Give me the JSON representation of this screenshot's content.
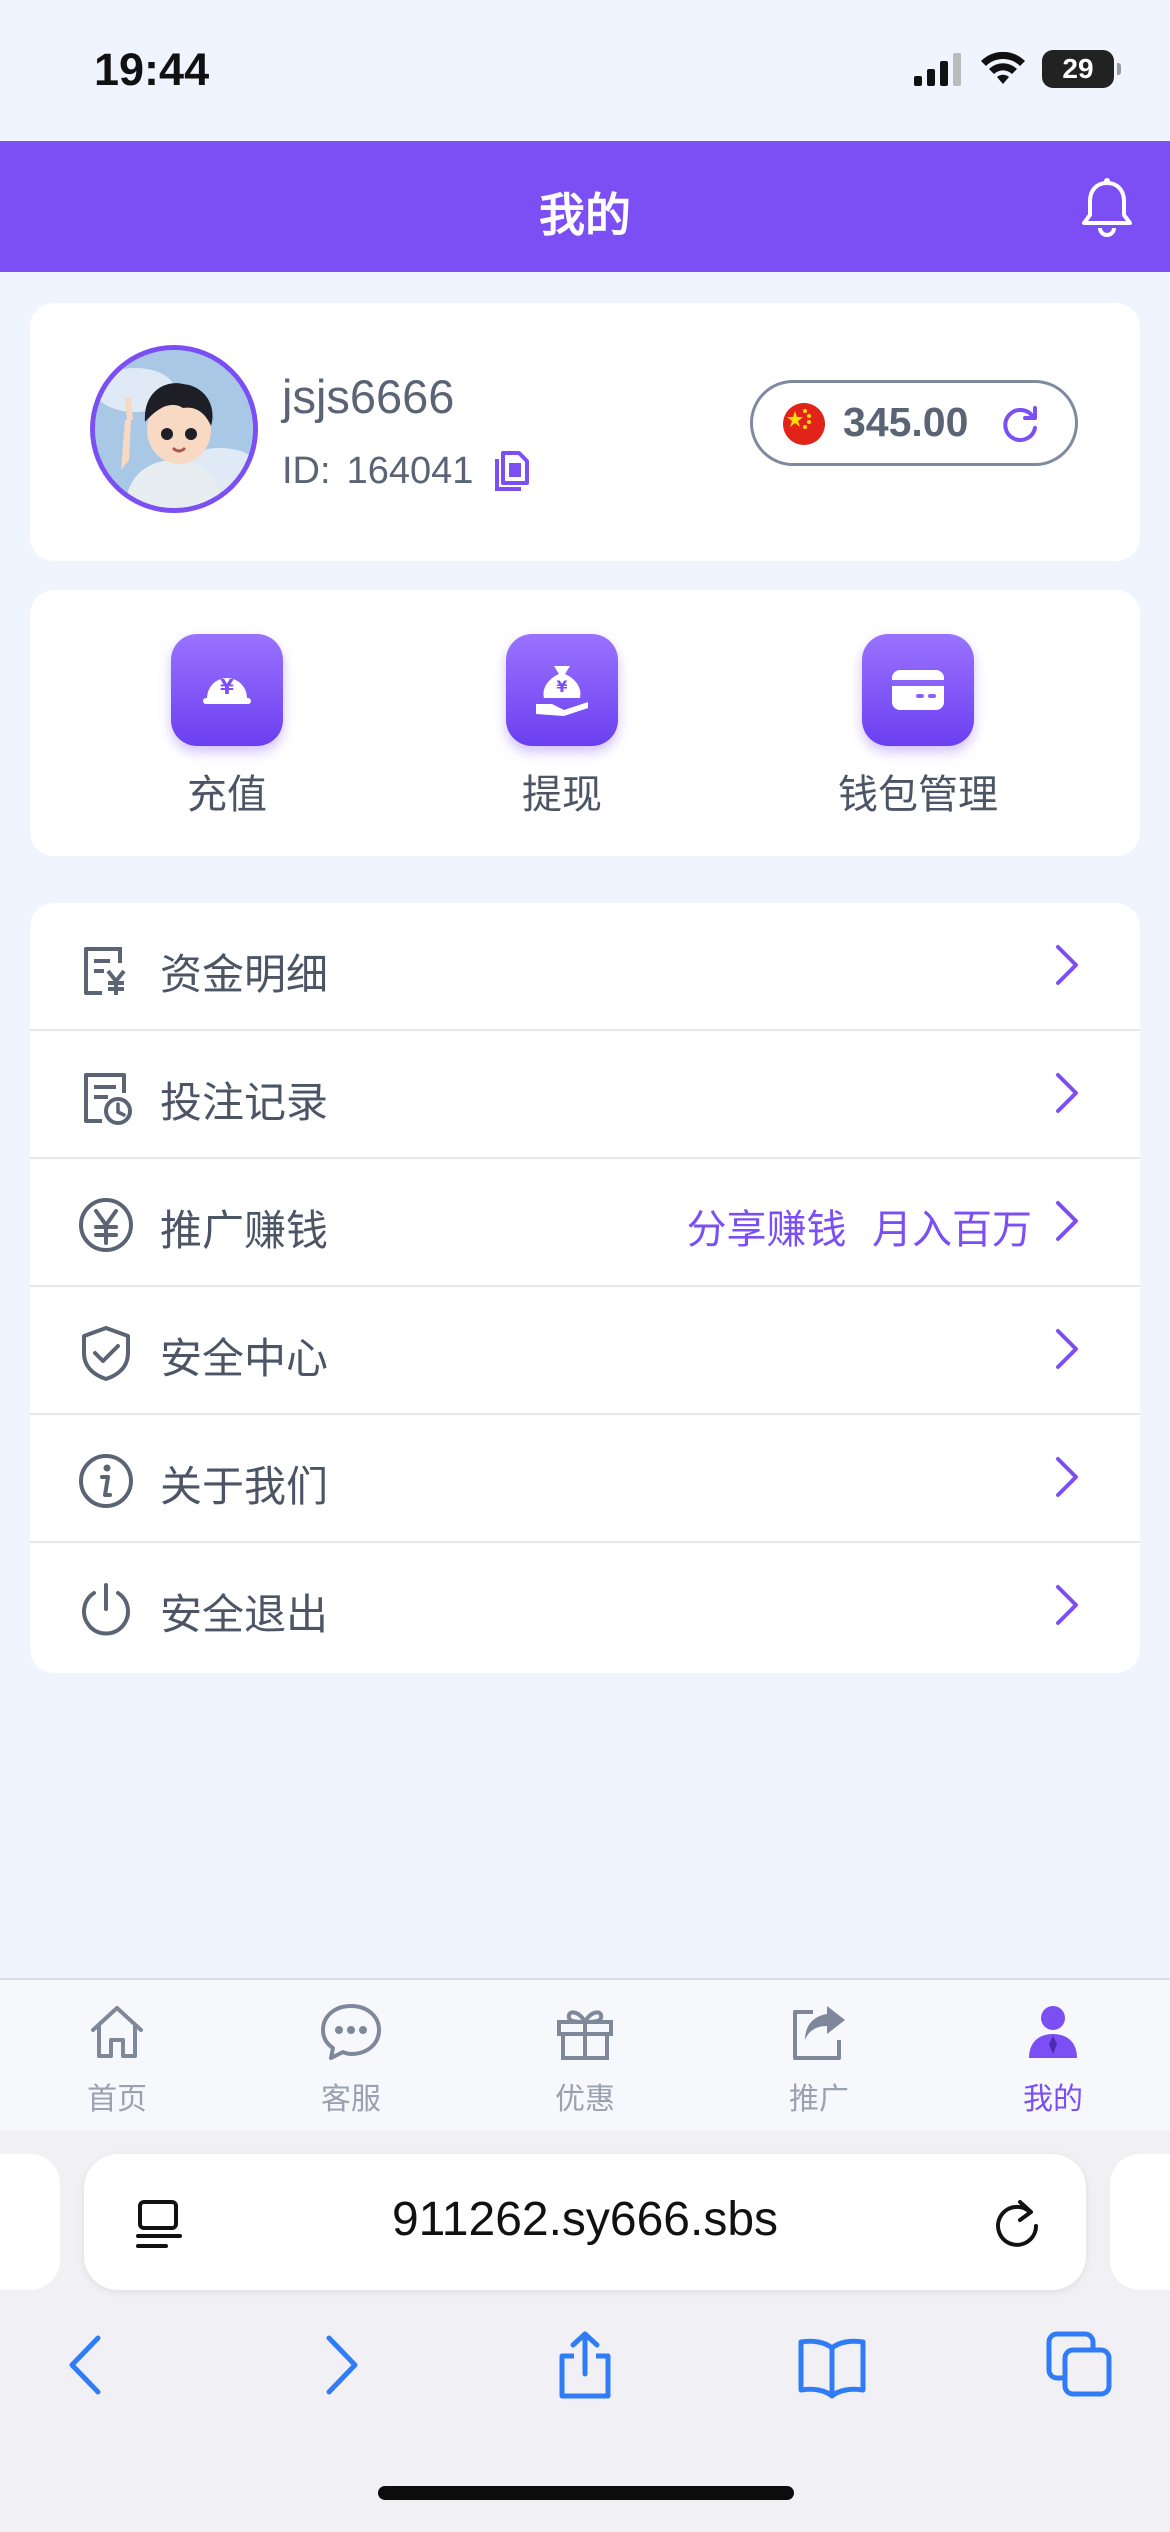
{
  "status_bar": {
    "time": "19:44",
    "battery": "29"
  },
  "header": {
    "title": "我的"
  },
  "profile": {
    "username": "jsjs6666",
    "id_label": "ID:",
    "id_value": "164041",
    "balance": "345.00"
  },
  "actions": [
    {
      "label": "充值",
      "icon": "deposit-icon"
    },
    {
      "label": "提现",
      "icon": "withdraw-icon"
    },
    {
      "label": "钱包管理",
      "icon": "wallet-icon"
    }
  ],
  "menu": [
    {
      "label": "资金明细",
      "icon": "fund-detail-icon",
      "extra": ""
    },
    {
      "label": "投注记录",
      "icon": "bet-record-icon",
      "extra": ""
    },
    {
      "label": "推广赚钱",
      "icon": "promote-yen-icon",
      "extra": "分享赚钱  月入百万"
    },
    {
      "label": "安全中心",
      "icon": "shield-check-icon",
      "extra": ""
    },
    {
      "label": "关于我们",
      "icon": "info-icon",
      "extra": ""
    },
    {
      "label": "安全退出",
      "icon": "power-icon",
      "extra": ""
    }
  ],
  "tabbar": [
    {
      "label": "首页",
      "icon": "home-icon",
      "active": false
    },
    {
      "label": "客服",
      "icon": "chat-icon",
      "active": false
    },
    {
      "label": "优惠",
      "icon": "gift-icon",
      "active": false
    },
    {
      "label": "推广",
      "icon": "share-icon",
      "active": false
    },
    {
      "label": "我的",
      "icon": "user-icon",
      "active": true
    }
  ],
  "browser": {
    "url": "911262.sy666.sbs"
  },
  "colors": {
    "accent": "#7b4ff3",
    "background": "#eff4fe",
    "text": "#4c5566"
  }
}
